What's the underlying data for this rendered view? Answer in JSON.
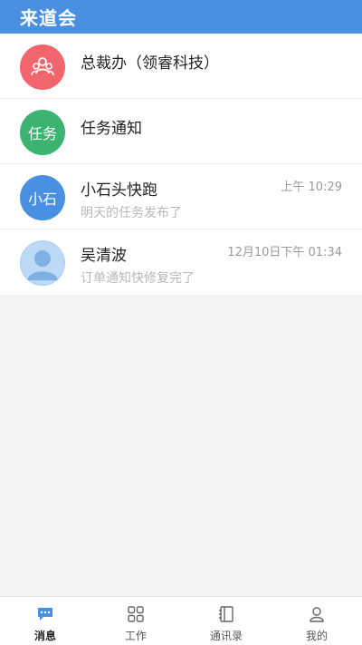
{
  "app": {
    "title": "来道会"
  },
  "messages": [
    {
      "name": "总裁办（领睿科技）",
      "preview": "",
      "time": "",
      "avatar_text": "",
      "avatar_icon": "group-icon",
      "avatar_color": "#f2656d"
    },
    {
      "name": "任务通知",
      "preview": "",
      "time": "",
      "avatar_text": "任务",
      "avatar_color": "#3cb371"
    },
    {
      "name": "小石头快跑",
      "preview": "明天的任务发布了",
      "time": "上午 10:29",
      "avatar_text": "小石",
      "avatar_color": "#4a90e2"
    },
    {
      "name": "吴清波",
      "preview": "订单通知快修复完了",
      "time": "12月10日下午 01:34",
      "avatar_text": "",
      "avatar_icon": "user-photo-icon",
      "avatar_color": "#a9cdf2"
    }
  ],
  "tabbar": {
    "accent": "#4a90e2",
    "items": [
      {
        "label": "消息",
        "icon": "chat-bubble-icon",
        "active": true
      },
      {
        "label": "工作",
        "icon": "grid-icon",
        "active": false
      },
      {
        "label": "通讯录",
        "icon": "contacts-book-icon",
        "active": false
      },
      {
        "label": "我的",
        "icon": "person-icon",
        "active": false
      }
    ]
  }
}
